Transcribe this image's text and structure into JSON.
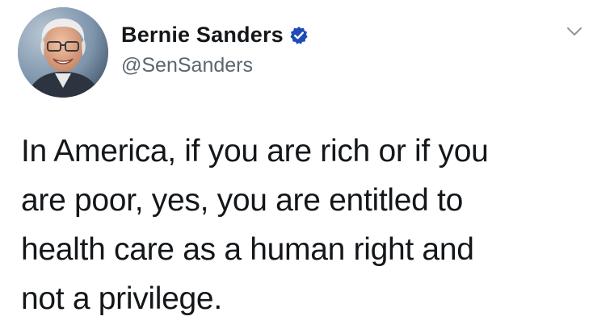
{
  "author": {
    "display_name": "Bernie Sanders",
    "handle": "@SenSanders",
    "verified_icon": "verified-badge-icon",
    "avatar_icon": "profile-photo-avatar"
  },
  "menu": {
    "icon": "chevron-down-icon"
  },
  "tweet": {
    "lines": [
      "In America, if you are rich or if you",
      "are poor, yes, you are entitled to",
      "health care as a human right and",
      "not a privilege."
    ]
  },
  "colors": {
    "text": "#14171a",
    "handle": "#5b6670",
    "verified": "#1d4bb8",
    "caret": "#8899a6"
  }
}
